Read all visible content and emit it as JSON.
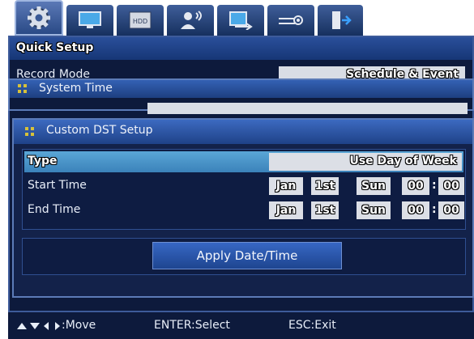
{
  "tabs": [
    {
      "icon": "gear-icon"
    },
    {
      "icon": "monitor-icon"
    },
    {
      "icon": "hdd-icon",
      "label": "HDD"
    },
    {
      "icon": "user-icon"
    },
    {
      "icon": "network-icon"
    },
    {
      "icon": "device-settings-icon"
    },
    {
      "icon": "exit-icon"
    }
  ],
  "quick_setup": {
    "title": "Quick Setup",
    "record_mode_label": "Record Mode",
    "record_mode_value": "Schedule & Event"
  },
  "system_time": {
    "title": "System Time"
  },
  "dst": {
    "title": "Custom DST Setup",
    "type_label": "Type",
    "type_value": "Use Day of Week",
    "start_label": "Start Time",
    "end_label": "End Time",
    "start": {
      "month": "Jan",
      "week": "1st",
      "day": "Sun",
      "hour": "00",
      "minute": "00"
    },
    "end": {
      "month": "Jan",
      "week": "1st",
      "day": "Sun",
      "hour": "00",
      "minute": "00"
    },
    "apply_label": "Apply Date/Time"
  },
  "status_bar": {
    "move": ":Move",
    "select": "ENTER:Select",
    "exit": "ESC:Exit"
  },
  "colors": {
    "accent": "#3b82ba",
    "panel": "#0d1a3c",
    "title": "#1f4288"
  }
}
